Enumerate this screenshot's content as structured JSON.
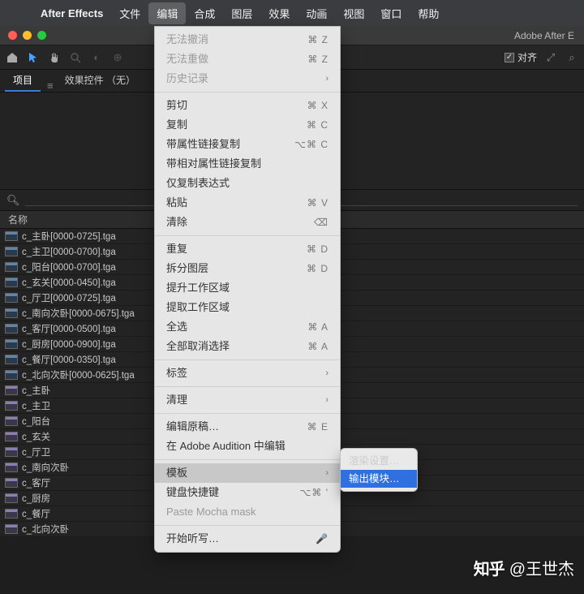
{
  "menubar": {
    "app": "After Effects",
    "items": [
      "文件",
      "编辑",
      "合成",
      "图层",
      "效果",
      "动画",
      "视图",
      "窗口",
      "帮助"
    ],
    "active_index": 1
  },
  "window": {
    "title": "Adobe After E"
  },
  "toolbar": {
    "align_label": "对齐"
  },
  "panel": {
    "tab_project": "项目",
    "tab_effect_controls": "效果控件 （无）",
    "search_placeholder": "",
    "column_name": "名称"
  },
  "project_items": [
    {
      "type": "footage",
      "name": "c_主卧[0000-0725].tga"
    },
    {
      "type": "footage",
      "name": "c_主卫[0000-0700].tga"
    },
    {
      "type": "footage",
      "name": "c_阳台[0000-0700].tga"
    },
    {
      "type": "footage",
      "name": "c_玄关[0000-0450].tga"
    },
    {
      "type": "footage",
      "name": "c_厅卫[0000-0725].tga"
    },
    {
      "type": "footage",
      "name": "c_南向次卧[0000-0675].tga"
    },
    {
      "type": "footage",
      "name": "c_客厅[0000-0500].tga"
    },
    {
      "type": "footage",
      "name": "c_厨房[0000-0900].tga"
    },
    {
      "type": "footage",
      "name": "c_餐厅[0000-0350].tga"
    },
    {
      "type": "footage",
      "name": "c_北向次卧[0000-0625].tga"
    },
    {
      "type": "comp",
      "name": "c_主卧"
    },
    {
      "type": "comp",
      "name": "c_主卫"
    },
    {
      "type": "comp",
      "name": "c_阳台"
    },
    {
      "type": "comp",
      "name": "c_玄关"
    },
    {
      "type": "comp",
      "name": "c_厅卫"
    },
    {
      "type": "comp",
      "name": "c_南向次卧"
    },
    {
      "type": "comp",
      "name": "c_客厅"
    },
    {
      "type": "comp",
      "name": "c_厨房"
    },
    {
      "type": "comp",
      "name": "c_餐厅"
    },
    {
      "type": "comp",
      "name": "c_北向次卧"
    }
  ],
  "edit_menu": [
    {
      "label": "无法撤消",
      "shortcut": "⌘ Z",
      "disabled": true
    },
    {
      "label": "无法重做",
      "shortcut": "⌘ Z",
      "disabled": true
    },
    {
      "label": "历史记录",
      "submenu": true,
      "disabled": true
    },
    {
      "sep": true
    },
    {
      "label": "剪切",
      "shortcut": "⌘ X"
    },
    {
      "label": "复制",
      "shortcut": "⌘ C"
    },
    {
      "label": "带属性链接复制",
      "shortcut": "⌥⌘ C"
    },
    {
      "label": "带相对属性链接复制"
    },
    {
      "label": "仅复制表达式"
    },
    {
      "label": "粘贴",
      "shortcut": "⌘ V"
    },
    {
      "label": "清除",
      "shortcut": "⌫"
    },
    {
      "sep": true
    },
    {
      "label": "重复",
      "shortcut": "⌘ D"
    },
    {
      "label": "拆分图层",
      "shortcut": "⌘ D"
    },
    {
      "label": "提升工作区域"
    },
    {
      "label": "提取工作区域"
    },
    {
      "label": "全选",
      "shortcut": "⌘ A"
    },
    {
      "label": "全部取消选择",
      "shortcut": "⌘ A"
    },
    {
      "sep": true
    },
    {
      "label": "标签",
      "submenu": true
    },
    {
      "sep": true
    },
    {
      "label": "清理",
      "submenu": true
    },
    {
      "sep": true
    },
    {
      "label": "编辑原稿…",
      "shortcut": "⌘ E"
    },
    {
      "label": "在 Adobe Audition 中编辑"
    },
    {
      "sep": true
    },
    {
      "label": "模板",
      "submenu": true,
      "hover": true
    },
    {
      "label": "键盘快捷键",
      "shortcut": "⌥⌘ '"
    },
    {
      "label": "Paste Mocha mask",
      "disabled": true
    },
    {
      "sep": true
    },
    {
      "label": "开始听写…",
      "shortcut": "🎤"
    }
  ],
  "submenu_template": {
    "items": [
      "渲染设置…",
      "输出模块…"
    ],
    "selected_index": 1
  },
  "watermark": {
    "logo": "知乎",
    "text": "@王世杰"
  }
}
